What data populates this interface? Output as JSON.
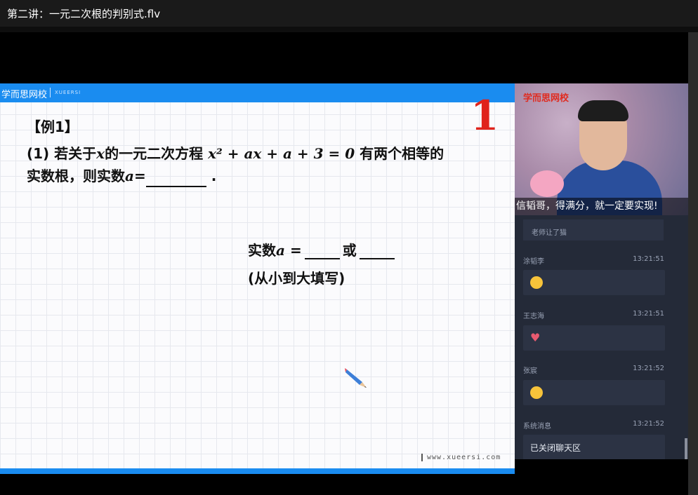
{
  "window": {
    "title": "第二讲：一元二次根的判别式.flv"
  },
  "slide": {
    "brand": "学而思网校",
    "brand_sub": "XUEERSI",
    "big_number": "1",
    "example_label": "【例1】",
    "question_prefix": "(1) 若关于",
    "question_var": "x",
    "question_mid": "的一元二次方程",
    "question_equation": "x² + ax + a + 3 = 0",
    "question_suffix": "有两个相等的",
    "question_line2_prefix": "实数根，则实数",
    "question_line2_var": "a",
    "question_line2_eq": "=",
    "question_end": ".",
    "answer_prefix": "实数",
    "answer_var": "a",
    "answer_eq": "=",
    "answer_or": "或",
    "hint": "(从小到大填写)",
    "website": "www.xueersi.com"
  },
  "webcam": {
    "logo": "学而思网校",
    "caption": "信韬哥，得满分，就一定要实现!"
  },
  "chat": {
    "partial_text": "老师让了猫",
    "messages": [
      {
        "name": "涂韬李",
        "time": "13:21:51",
        "content_type": "smile-emoji"
      },
      {
        "name": "王志海",
        "time": "13:21:51",
        "content_type": "heart-emoji"
      },
      {
        "name": "张宸",
        "time": "13:21:52",
        "content_type": "smile-emoji"
      },
      {
        "name": "系统消息",
        "time": "13:21:52",
        "text": "已关闭聊天区"
      }
    ]
  },
  "colors": {
    "accent_blue": "#1a8cf0",
    "number_red": "#e0231b",
    "chat_bg": "#242a38"
  }
}
